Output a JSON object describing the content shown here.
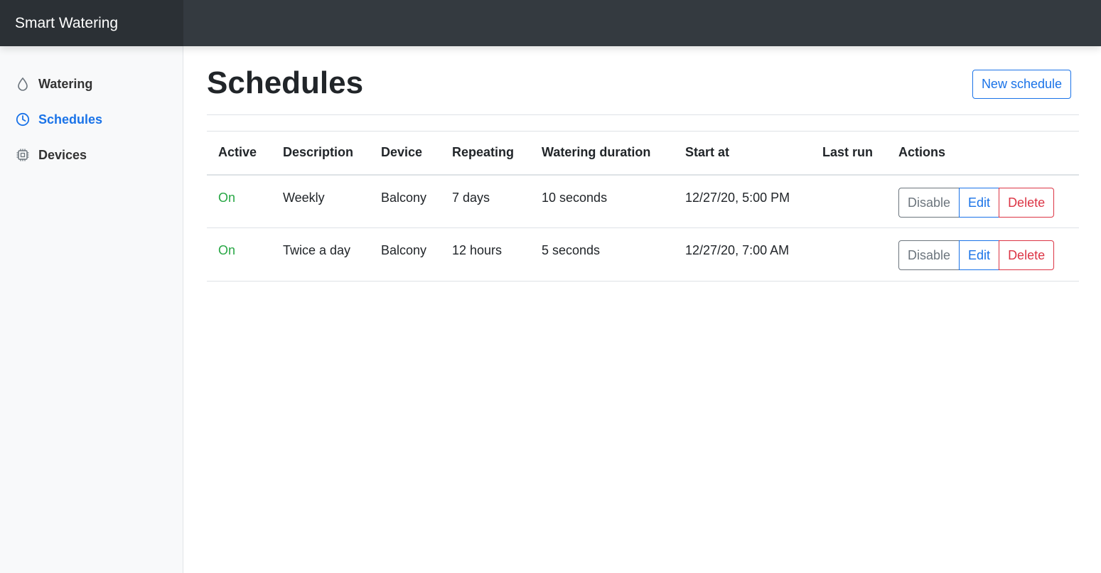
{
  "app": {
    "title": "Smart Watering"
  },
  "sidebar": {
    "items": [
      {
        "label": "Watering",
        "icon": "droplet-icon",
        "active": false
      },
      {
        "label": "Schedules",
        "icon": "clock-icon",
        "active": true
      },
      {
        "label": "Devices",
        "icon": "cpu-icon",
        "active": false
      }
    ]
  },
  "main": {
    "title": "Schedules",
    "new_button": "New schedule"
  },
  "table": {
    "columns": [
      "Active",
      "Description",
      "Device",
      "Repeating",
      "Watering duration",
      "Start at",
      "Last run",
      "Actions"
    ],
    "rows": [
      {
        "active": "On",
        "description": "Weekly",
        "device": "Balcony",
        "repeating": "7 days",
        "duration": "10 seconds",
        "start_at": "12/27/20, 5:00 PM",
        "last_run": ""
      },
      {
        "active": "On",
        "description": "Twice a day",
        "device": "Balcony",
        "repeating": "12 hours",
        "duration": "5 seconds",
        "start_at": "12/27/20, 7:00 AM",
        "last_run": ""
      }
    ],
    "actions": {
      "disable": "Disable",
      "edit": "Edit",
      "delete": "Delete"
    }
  },
  "colors": {
    "accent": "#1a73e8",
    "on": "#28a745",
    "danger": "#dc3545",
    "topbar": "#343a40"
  }
}
